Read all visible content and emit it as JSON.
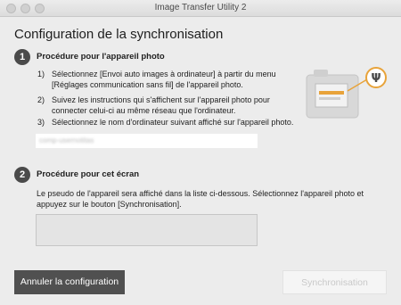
{
  "window": {
    "title": "Image Transfer Utility 2"
  },
  "page": {
    "title": "Configuration de la synchronisation"
  },
  "step1": {
    "number": "1",
    "heading": "Procédure pour l'appareil photo",
    "items": [
      {
        "num": "1)",
        "line1": "Sélectionnez [Envoi auto images à ordinateur] à partir du menu",
        "line2": "[Réglages communication sans fil] de l'appareil photo."
      },
      {
        "num": "2)",
        "line1": "Suivez les instructions qui s'affichent sur l'appareil photo pour",
        "line2": "connecter celui-ci au même réseau que l'ordinateur."
      },
      {
        "num": "3)",
        "line1": "Sélectionnez le nom d'ordinateur suivant affiché sur l'appareil photo.",
        "line2": ""
      }
    ],
    "computer_name": "comp-usernotitas"
  },
  "step2": {
    "number": "2",
    "heading": "Procédure pour cet écran",
    "line1": "Le pseudo de l'appareil sera affiché dans la liste ci-dessous. Sélectionnez l'appareil photo et",
    "line2": "appuyez sur le bouton [Synchronisation]."
  },
  "buttons": {
    "cancel": "Annuler la configuration",
    "sync": "Synchronisation"
  },
  "colors": {
    "accent_orange": "#e8a33a",
    "dark_button": "#505050"
  }
}
